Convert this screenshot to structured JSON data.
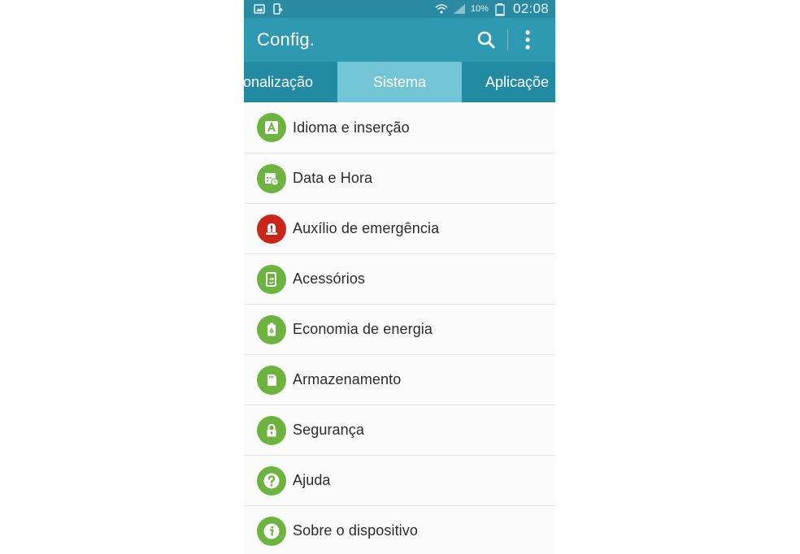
{
  "status_bar": {
    "battery_percent": "10%",
    "time": "02:08"
  },
  "action_bar": {
    "title": "Config."
  },
  "tabs": [
    {
      "label": "sonalização",
      "selected": false
    },
    {
      "label": "Sistema",
      "selected": true
    },
    {
      "label": "Aplicaçõe",
      "selected": false
    }
  ],
  "colors": {
    "status_bar": "#2a8aa2",
    "action_bar": "#2f99b1",
    "tab_bar": "#238aa3",
    "tab_selected": "#73c5d6",
    "icon_green": "#6db33f",
    "icon_red": "#c8251b"
  },
  "settings": [
    {
      "label": "Idioma e inserção",
      "icon": "language-icon",
      "color": "#6db33f"
    },
    {
      "label": "Data e Hora",
      "icon": "calendar-clock-icon",
      "color": "#6db33f"
    },
    {
      "label": "Auxílio de emergência",
      "icon": "emergency-icon",
      "color": "#c8251b"
    },
    {
      "label": "Acessórios",
      "icon": "accessories-icon",
      "color": "#6db33f"
    },
    {
      "label": "Economia de energia",
      "icon": "battery-recycle-icon",
      "color": "#6db33f"
    },
    {
      "label": "Armazenamento",
      "icon": "storage-icon",
      "color": "#6db33f"
    },
    {
      "label": "Segurança",
      "icon": "lock-icon",
      "color": "#6db33f"
    },
    {
      "label": "Ajuda",
      "icon": "help-icon",
      "color": "#6db33f"
    },
    {
      "label": "Sobre o dispositivo",
      "icon": "info-icon",
      "color": "#6db33f"
    }
  ]
}
